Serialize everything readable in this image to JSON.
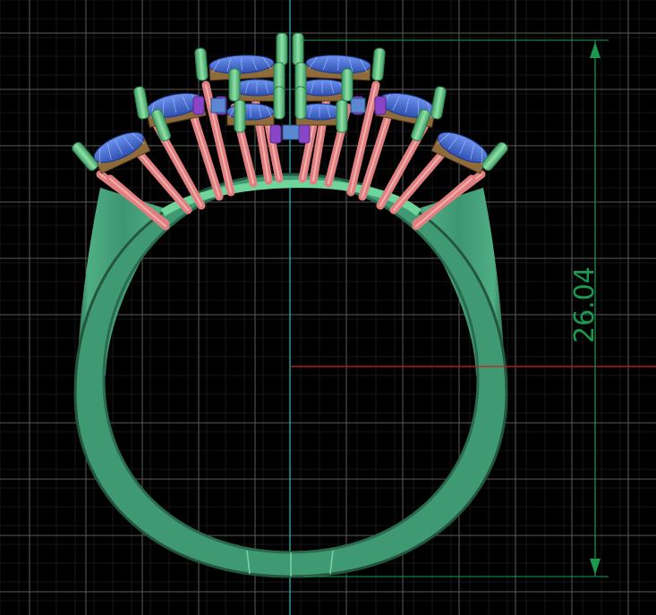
{
  "viewport": {
    "background": "#000000",
    "grid_color": "#5a5a5a",
    "axis_vertical_color": "#18c6c6",
    "axis_horizontal_color": "#cc1f1f"
  },
  "model": {
    "object": "ring",
    "band_color": "#3f9a73",
    "band_shadow_color": "#2c6f52",
    "band_highlight_color": "#66c79a",
    "prong_color": "#5ec47f",
    "support_rod_color": "#e07f7f",
    "stone_color": "#4a72d9",
    "setting_color": "#8f6a3a",
    "connector_color": "#8a45c7"
  },
  "dimension": {
    "value": "26.04",
    "color": "#1a9a4e"
  }
}
